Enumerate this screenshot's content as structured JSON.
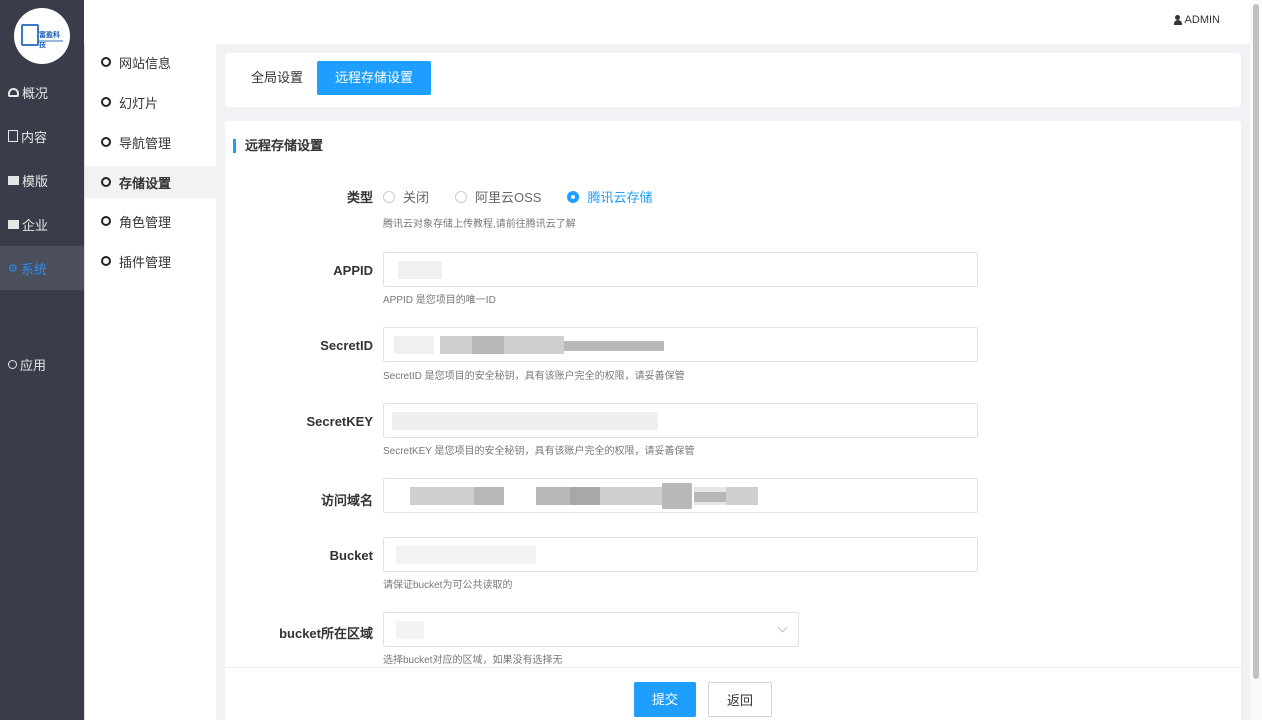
{
  "header": {
    "user_label": "ADMIN"
  },
  "logo": {
    "text": "富盈科技"
  },
  "rail": {
    "items": [
      {
        "label": "概况",
        "icon": "dashboard-icon"
      },
      {
        "label": "内容",
        "icon": "document-icon"
      },
      {
        "label": "模版",
        "icon": "template-icon"
      },
      {
        "label": "企业",
        "icon": "enterprise-icon"
      },
      {
        "label": "系统",
        "icon": "gear-icon",
        "active": true
      },
      {
        "label": "应用",
        "icon": "ring-icon"
      }
    ]
  },
  "submenu": {
    "items": [
      {
        "label": "网站信息"
      },
      {
        "label": "幻灯片"
      },
      {
        "label": "导航管理"
      },
      {
        "label": "存储设置",
        "active": true
      },
      {
        "label": "角色管理"
      },
      {
        "label": "插件管理"
      }
    ]
  },
  "tabs": [
    {
      "label": "全局设置"
    },
    {
      "label": "远程存储设置",
      "active": true
    }
  ],
  "form": {
    "section_title": "远程存储设置",
    "type": {
      "label": "类型",
      "options": [
        "关闭",
        "阿里云OSS",
        "腾讯云存储"
      ],
      "selected": "腾讯云存储",
      "help": "腾讯云对象存储上传教程,请前往腾讯云了解"
    },
    "appid": {
      "label": "APPID",
      "help": "APPID 是您项目的唯一ID"
    },
    "secret_id": {
      "label": "SecretID",
      "help": "SecretID 是您项目的安全秘钥，具有该账户完全的权限，请妥善保管"
    },
    "secret_key": {
      "label": "SecretKEY",
      "help": "SecretKEY 是您项目的安全秘钥，具有该账户完全的权限，请妥善保管"
    },
    "domain": {
      "label": "访问域名"
    },
    "bucket": {
      "label": "Bucket",
      "help": "请保证bucket为可公共读取的"
    },
    "region": {
      "label": "bucket所在区域",
      "help": "选择bucket对应的区域，如果没有选择无"
    }
  },
  "actions": {
    "submit": "提交",
    "back": "返回"
  },
  "colors": {
    "accent": "#1e9fff",
    "rail_bg": "#393d49"
  }
}
